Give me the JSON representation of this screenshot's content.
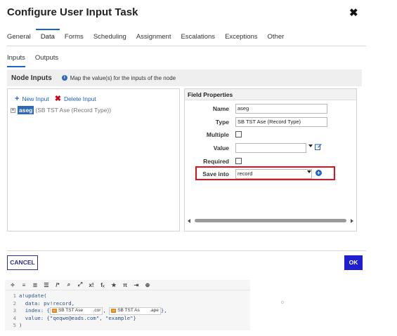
{
  "dialog": {
    "title": "Configure User Input Task",
    "close_symbol": "✖"
  },
  "tabs": [
    "General",
    "Data",
    "Forms",
    "Scheduling",
    "Assignment",
    "Escalations",
    "Exceptions",
    "Other"
  ],
  "active_tab": "Data",
  "subtabs": [
    "Inputs",
    "Outputs"
  ],
  "active_subtab": "Inputs",
  "node_inputs": {
    "title": "Node Inputs",
    "help": "Map the value(s) for the inputs of the node"
  },
  "tree": {
    "new_input": "New Input",
    "delete_input": "Delete Input",
    "expander": "+",
    "node_name": "aseg",
    "node_type": "(SB TST Ase (Record Type))"
  },
  "field_properties": {
    "title": "Field Properties",
    "labels": {
      "name": "Name",
      "type": "Type",
      "multiple": "Multiple",
      "value": "Value",
      "required": "Required",
      "save_into": "Save into"
    },
    "name_value": "aseg",
    "type_value": "SB TST Ase (Record Type)",
    "value_value": "",
    "save_into_value": "record"
  },
  "footer": {
    "cancel": "CANCEL",
    "ok": "OK"
  },
  "editor": {
    "toolbar_icons": [
      "✧",
      "≡",
      "≣",
      "☰",
      "/*",
      "⌕",
      "⤢",
      "x!",
      "fₓ",
      "★",
      "π",
      "⇥",
      "⊕"
    ],
    "lines": [
      {
        "n": "1",
        "text": "a!update("
      },
      {
        "n": "2",
        "text": "  data: pv!record,"
      },
      {
        "n": "3",
        "text_before": "  index: {",
        "chip1": "SB TST Ase        .cor",
        "mid": ", ",
        "chip2": "SB TST As        .ape",
        "text_after": "},"
      },
      {
        "n": "4",
        "text": "  value: {\"qeqwe@eads.com\", \"example\"}"
      },
      {
        "n": "5",
        "text": ")"
      }
    ],
    "chip_icon": "rt",
    "fold_hint": "o"
  }
}
